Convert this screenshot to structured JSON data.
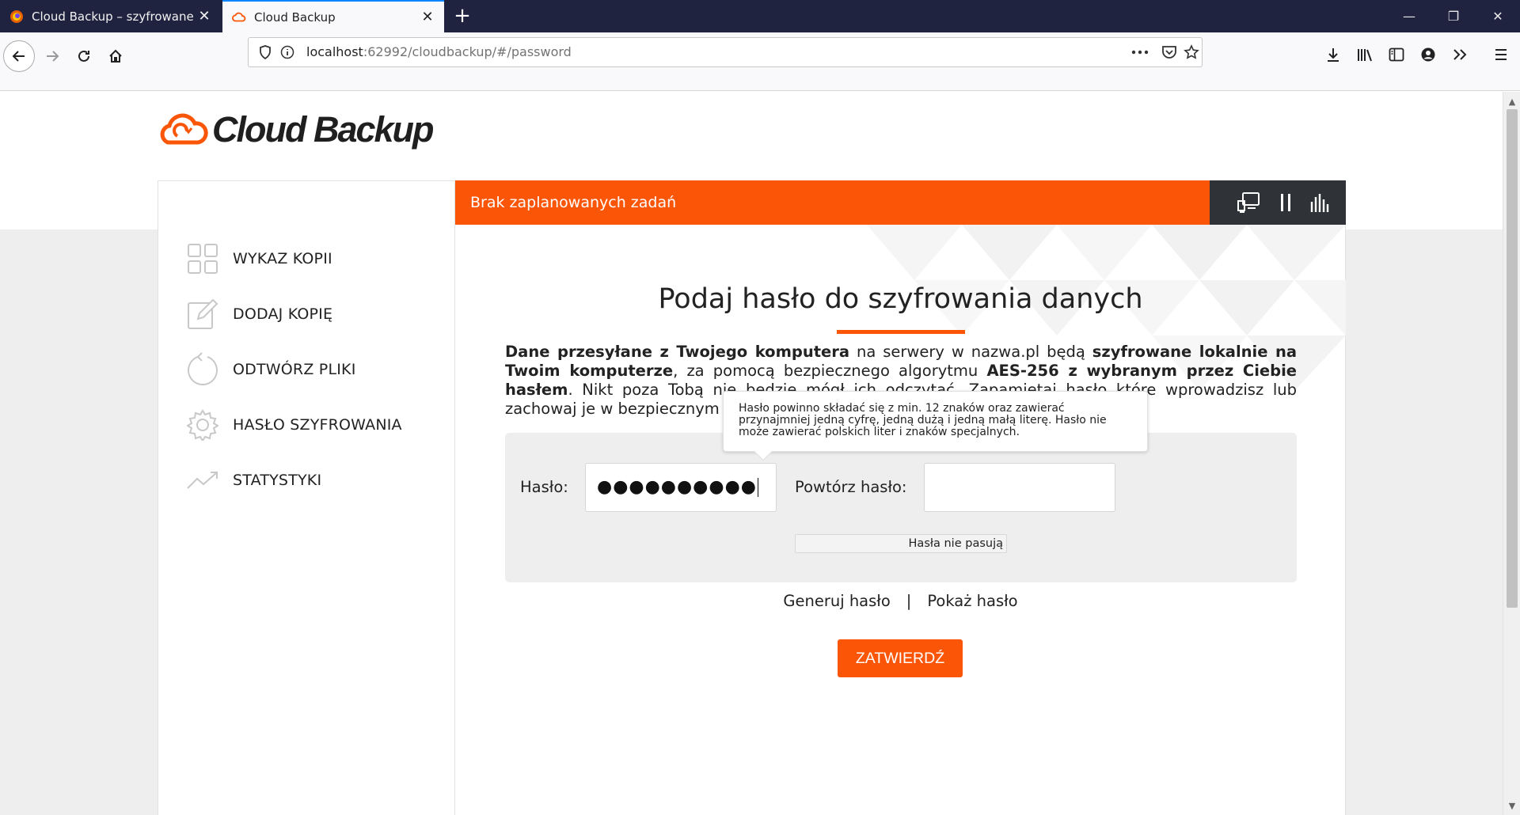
{
  "browser": {
    "tabs": [
      {
        "title": "Cloud Backup – szyfrowane ko",
        "active": false
      },
      {
        "title": "Cloud Backup",
        "active": true
      }
    ],
    "new_tab": "+",
    "url": {
      "host": "localhost",
      "rest": ":62992/cloudbackup/#/password"
    },
    "window_controls": {
      "minimize": "—",
      "restore": "❐",
      "close": "✕"
    }
  },
  "app": {
    "logo_text": "Cloud Backup",
    "status_text": "Brak zaplanowanych zadań",
    "sidebar": [
      {
        "label": "WYKAZ KOPII",
        "icon": "grid-icon"
      },
      {
        "label": "DODAJ KOPIĘ",
        "icon": "edit-icon"
      },
      {
        "label": "ODTWÓRZ PLIKI",
        "icon": "restore-icon"
      },
      {
        "label": "HASŁO SZYFROWANIA",
        "icon": "gear-icon"
      },
      {
        "label": "STATYSTYKI",
        "icon": "trend-icon"
      }
    ],
    "heading": "Podaj hasło do szyfrowania danych",
    "description": {
      "p1": "Dane przesyłane z Twojego komputera",
      "p2": " na serwery w nazwa.pl będą ",
      "p3": "szyfrowane lokalnie na Twoim komputerze",
      "p4": ", za pomocą bezpiecznego algorytmu ",
      "p5": "AES-256 z wybranym przez Ciebie hasłem",
      "p6": ". Nikt poza Tobą nie będzie mógł ich odczytać. Zapamiętaj hasło które wprowadzisz lub zachowaj je w bezpiecznym miejscu."
    },
    "form": {
      "password_label": "Hasło:",
      "password_value": "●●●●●●●●●●",
      "repeat_label": "Powtórz hasło:",
      "repeat_value": "",
      "match_status": "Hasła nie pasują"
    },
    "tooltip": "Hasło powinno składać się z min. 12 znaków oraz zawierać przynajmniej jedną cyfrę, jedną dużą i jedną małą literę. Hasło nie może zawierać polskich liter i znaków specjalnych.",
    "links": {
      "generate": "Generuj hasło",
      "separator": "|",
      "show": "Pokaż hasło"
    },
    "submit": "ZATWIERDŹ",
    "colors": {
      "accent": "#fb5607",
      "dark": "#2f3337"
    }
  }
}
